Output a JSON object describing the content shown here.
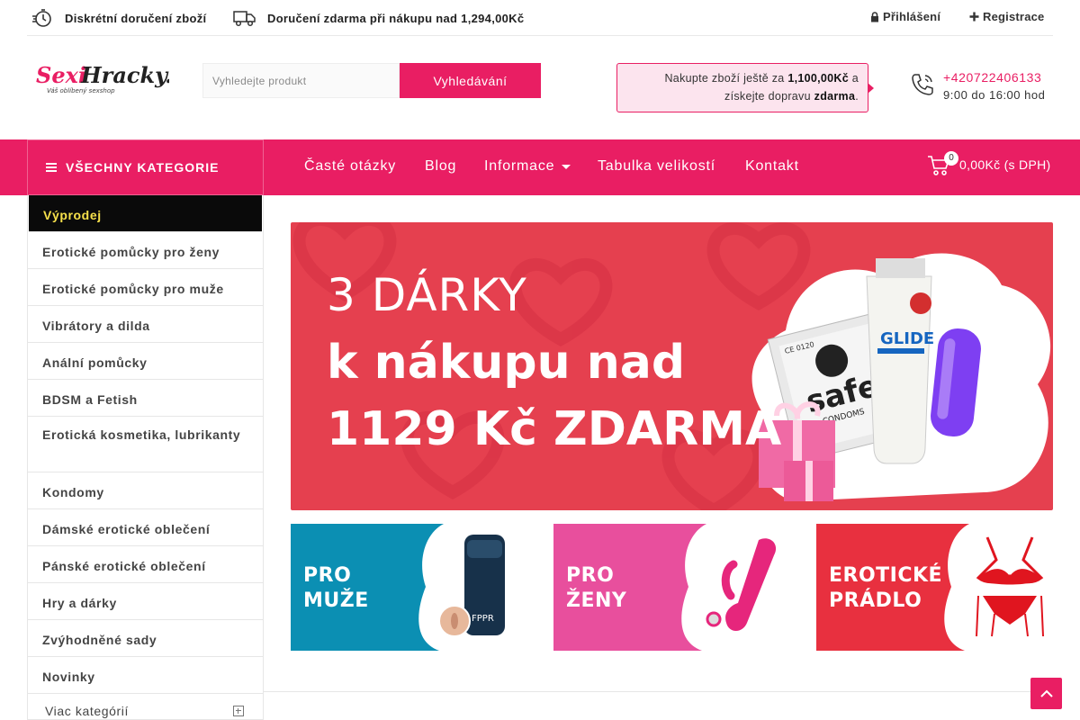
{
  "topbar": {
    "discreet": "Diskrétní doručení zboží",
    "free_shipping": "Doručení zdarma při nákupu nad 1,294,00Kč",
    "login": "Přihlášení",
    "register": "Registrace"
  },
  "header": {
    "logo_text": "SexiHracky.cz",
    "logo_tagline": "Váš oblíbený sexshop",
    "search_placeholder": "Vyhledejte produkt",
    "search_button": "Vyhledávání",
    "promo_prefix": "Nakupte zboží ještě za ",
    "promo_amount": "1,100,00Kč",
    "promo_mid": " a získejte dopravu ",
    "promo_free": "zdarma",
    "promo_suffix": ".",
    "phone": "+420722406133",
    "hours": "9:00 do 16:00 hod"
  },
  "nav": {
    "all_categories": "VŠECHNY KATEGORIE",
    "items": [
      "Časté otázky",
      "Blog",
      "Informace",
      "Tabulka velikostí",
      "Kontakt"
    ],
    "cart_count": "0",
    "cart_total": "0,00Kč (s DPH)"
  },
  "sidebar": {
    "items": [
      "Výprodej",
      "Erotické pomůcky pro ženy",
      "Erotické pomůcky pro muže",
      "Vibrátory a dilda",
      "Anální pomůcky",
      "BDSM a Fetish",
      "Erotická kosmetika, lubrikanty",
      "Kondomy",
      "Dámské erotické oblečení",
      "Pánské erotické oblečení",
      "Hry a dárky",
      "Zvýhodněné sady",
      "Novinky"
    ],
    "more": "Viac kategórií"
  },
  "banner": {
    "line1": "3 DÁRKY",
    "line2": "k nákupu nad",
    "line3": "1129 Kč ZDARMA",
    "condom_brand": "safe",
    "condom_sub": "CONDOMS",
    "lube_brand": "JUST GLIDE"
  },
  "tiles": [
    {
      "line1": "PRO",
      "line2": "MUŽE",
      "color": "#0b8fb3"
    },
    {
      "line1": "PRO",
      "line2": "ŽENY",
      "color": "#e84f9d"
    },
    {
      "line1": "EROTICKÉ",
      "line2": "PRÁDLO",
      "color": "#e8303f"
    }
  ],
  "colors": {
    "accent": "#e91e63",
    "sale_bg": "#0a0a0a",
    "sale_text": "#f7e14b"
  }
}
